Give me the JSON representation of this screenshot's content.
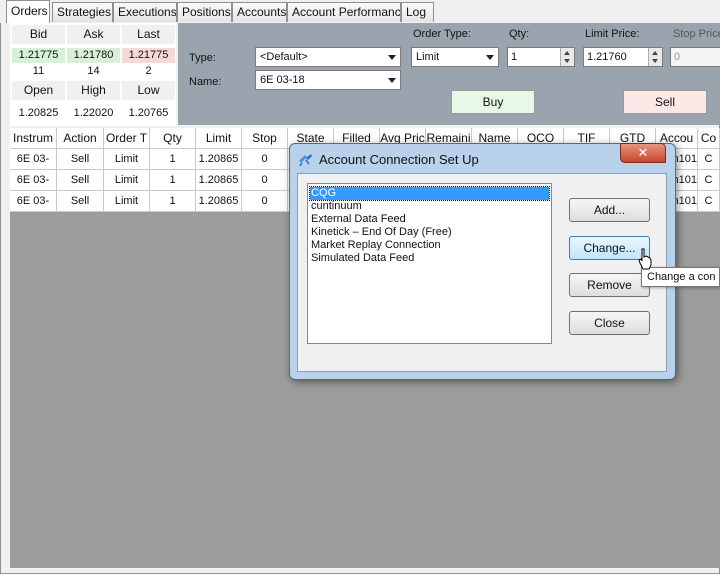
{
  "tabs": [
    {
      "label": "Orders",
      "active": true
    },
    {
      "label": "Strategies"
    },
    {
      "label": "Executions"
    },
    {
      "label": "Positions"
    },
    {
      "label": "Accounts"
    },
    {
      "label": "Account Performance"
    },
    {
      "label": "Log"
    }
  ],
  "market": {
    "headers1": [
      "Bid",
      "Ask",
      "Last"
    ],
    "prices": [
      "1.21775",
      "1.21780",
      "1.21775"
    ],
    "sizes": [
      "11",
      "14",
      "2"
    ],
    "headers2": [
      "Open",
      "High",
      "Low"
    ],
    "ohl": [
      "1.20825",
      "1.22020",
      "1.20765"
    ],
    "colors": {
      "bid": "#d8f0d8",
      "ask": "#d8f0d8",
      "last": "#f5d8d8"
    }
  },
  "order_entry": {
    "type_label": "Type:",
    "type_value": "<Default>",
    "name_label": "Name:",
    "name_value": "6E 03-18",
    "order_type_label": "Order Type:",
    "order_type_value": "Limit",
    "qty_label": "Qty:",
    "qty_value": "1",
    "limit_price_label": "Limit Price:",
    "limit_price_value": "1.21760",
    "stop_price_label": "Stop Price:",
    "stop_price_value": "0",
    "buy_label": "Buy",
    "sell_label": "Sell",
    "colors": {
      "buy": "#e8f8e8",
      "sell": "#fde8e8"
    }
  },
  "grid": {
    "columns": [
      "Instrum",
      "Action",
      "Order T",
      "Qty",
      "Limit",
      "Stop",
      "State",
      "Filled",
      "Avg Pric",
      "Remaini",
      "Name",
      "OCO",
      "TIF",
      "GTD",
      "Accou",
      "Co"
    ],
    "rows": [
      {
        "instrument": "6E 03-",
        "action": "Sell",
        "order_type": "Limit",
        "qty": "1",
        "limit": "1.20865",
        "stop": "0",
        "account": "n101",
        "co": "C"
      },
      {
        "instrument": "6E 03-",
        "action": "Sell",
        "order_type": "Limit",
        "qty": "1",
        "limit": "1.20865",
        "stop": "0",
        "account": "n101",
        "co": "C"
      },
      {
        "instrument": "6E 03-",
        "action": "Sell",
        "order_type": "Limit",
        "qty": "1",
        "limit": "1.20865",
        "stop": "0",
        "account": "n101",
        "co": "C"
      }
    ]
  },
  "dialog": {
    "title": "Account Connection Set Up",
    "close_glyph": "✕",
    "connections": [
      "CQG",
      "cuntinuum",
      "External Data Feed",
      "Kinetick – End Of Day (Free)",
      "Market Replay Connection",
      "Simulated Data Feed"
    ],
    "selected_index": 0,
    "buttons": {
      "add": "Add...",
      "change": "Change...",
      "remove": "Remove",
      "close": "Close"
    },
    "tooltip": "Change a con"
  }
}
